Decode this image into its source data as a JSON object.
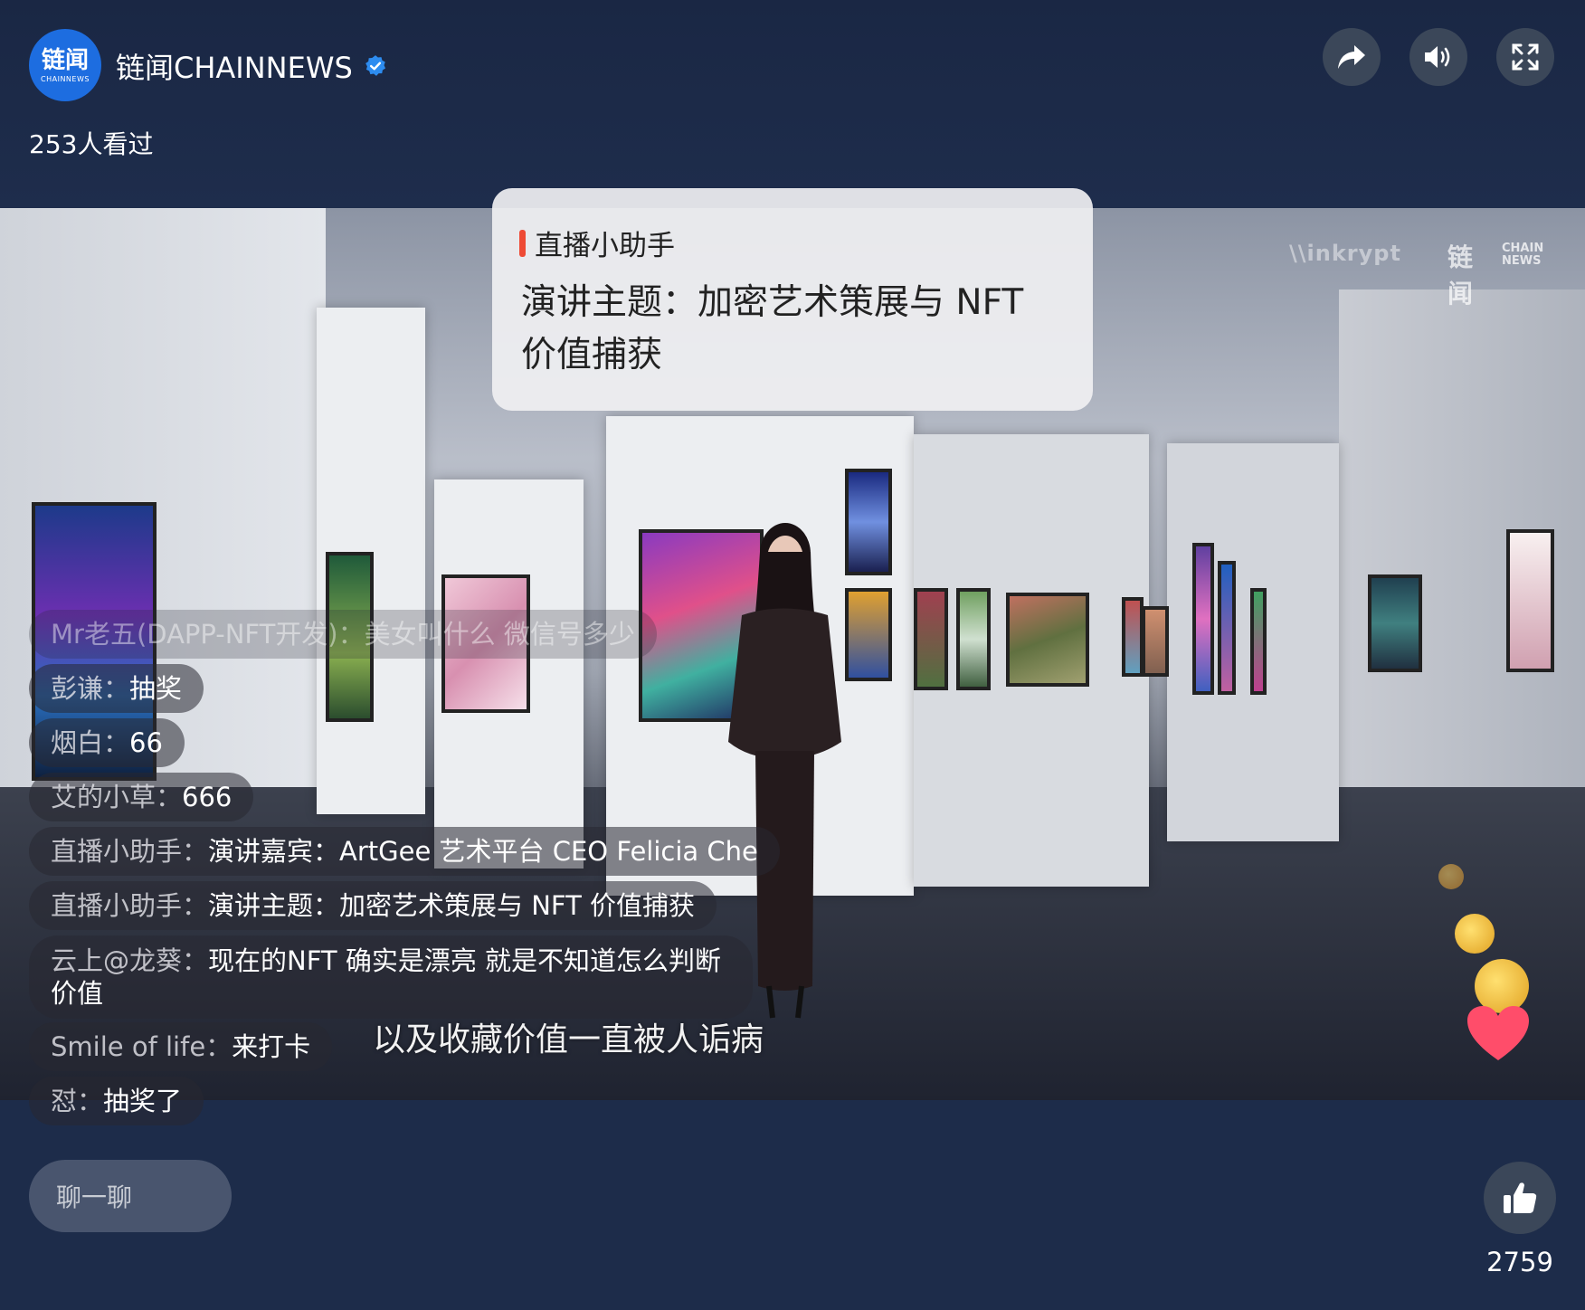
{
  "header": {
    "avatar_text": "链闻",
    "avatar_sub": "CHAINNEWS",
    "channel_name": "链闻CHAINNEWS",
    "views": "253人看过"
  },
  "video": {
    "watermark_left": "\\\\inkrypt",
    "watermark_logo": "链闻",
    "watermark_sub_1": "CHAIN",
    "watermark_sub_2": "NEWS",
    "subtitle": "以及收藏价值一直被人诟病"
  },
  "assistant_card": {
    "tag": "直播小助手",
    "message": "演讲主题：加密艺术策展与 NFT 价值捕获"
  },
  "chat": [
    {
      "user": "Mr老五(DAPP-NFT开发)：",
      "text": "美女叫什么 微信号多少"
    },
    {
      "user": "彭谦：",
      "text": "抽奖"
    },
    {
      "user": "烟白：",
      "text": "66"
    },
    {
      "user": "艾的小草：",
      "text": "666"
    },
    {
      "user": "直播小助手：",
      "text": "演讲嘉宾：ArtGee 艺术平台 CEO Felicia Che"
    },
    {
      "user": "直播小助手：",
      "text": "演讲主题：加密艺术策展与 NFT 价值捕获"
    },
    {
      "user": "云上@龙葵：",
      "text": "现在的NFT 确实是漂亮 就是不知道怎么判断价值"
    },
    {
      "user": "Smile of life：",
      "text": "来打卡"
    },
    {
      "user": "怼：",
      "text": "抽奖了"
    }
  ],
  "input": {
    "placeholder": "聊一聊"
  },
  "likes": {
    "count": "2759"
  },
  "colors": {
    "background": "#1d2c4a",
    "accent_blue": "#1d6de0",
    "tag_red": "#ee4a35"
  }
}
